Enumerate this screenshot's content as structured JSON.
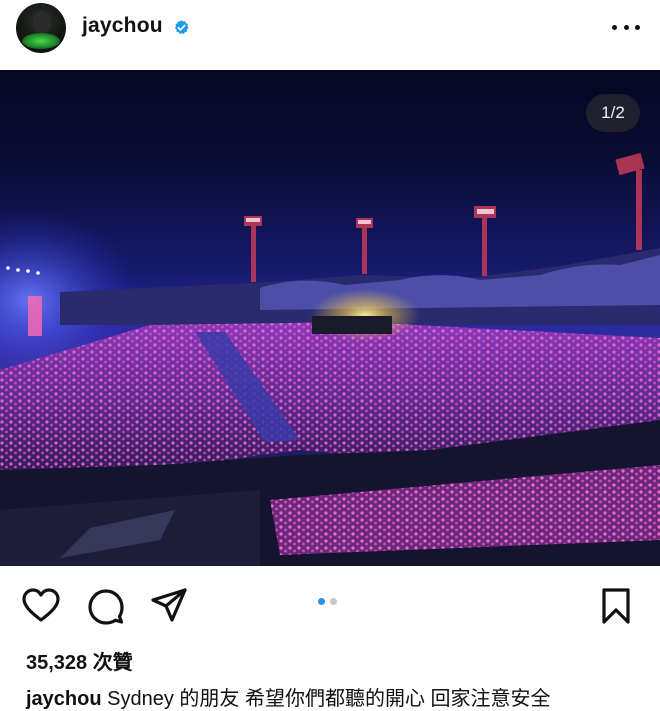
{
  "post": {
    "username": "jaychou",
    "verified": true,
    "avatar_icon": "profile-avatar",
    "image_counter": "1/2",
    "image_description_icon": "concert-stadium-photo",
    "likes": "35,328 次贊",
    "caption_text": "Sydney 的朋友 希望你們都聽的開心 回家注意安全"
  },
  "carousel": {
    "active_index": 0,
    "count": 2,
    "active_color": "#2b90e8",
    "inactive_color": "#c7c7c7"
  },
  "colors": {
    "verified": "#1d9bf0",
    "text": "#111111",
    "background": "#ffffff"
  }
}
